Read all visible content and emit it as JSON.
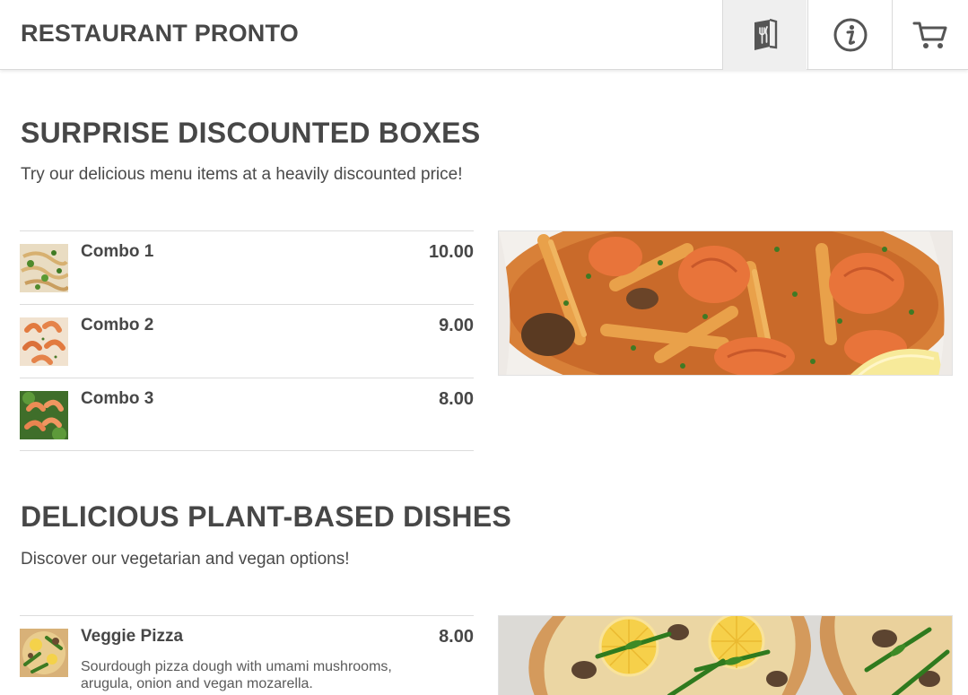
{
  "header": {
    "brand": "RESTAURANT PRONTO",
    "nav": [
      {
        "icon": "menu-book-icon",
        "active": true
      },
      {
        "icon": "info-icon",
        "active": false
      },
      {
        "icon": "cart-icon",
        "active": false
      }
    ]
  },
  "sections": [
    {
      "title": "SURPRISE DISCOUNTED BOXES",
      "description": "Try our delicious menu items at a heavily discounted price!",
      "hero_image": "shrimp-pasta-photo",
      "items": [
        {
          "name": "Combo 1",
          "price": "10.00",
          "image": "pasta-thumbnail"
        },
        {
          "name": "Combo 2",
          "price": "9.00",
          "image": "shrimp-thumbnail"
        },
        {
          "name": "Combo 3",
          "price": "8.00",
          "image": "shrimp-greens-thumbnail"
        }
      ]
    },
    {
      "title": "DELICIOUS PLANT-BASED DISHES",
      "description": "Discover our vegetarian and vegan options!",
      "hero_image": "veggie-pizza-photo",
      "items": [
        {
          "name": "Veggie Pizza",
          "price": "8.00",
          "description": "Sourdough pizza dough with umami mushrooms, arugula, onion and vegan mozarella.",
          "image": "veggie-pizza-thumbnail"
        }
      ]
    }
  ],
  "colors": {
    "text": "#474747",
    "border": "#dcdcdc",
    "active_nav": "#efefef"
  }
}
